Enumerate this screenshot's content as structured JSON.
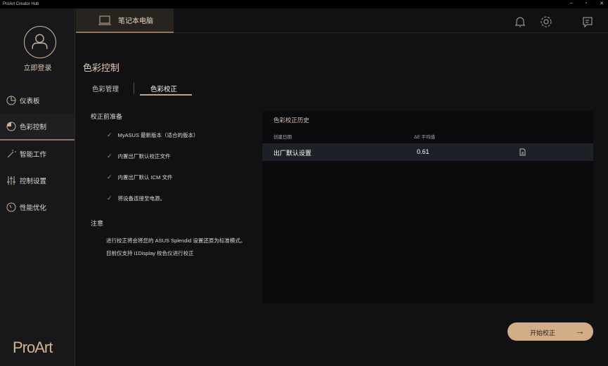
{
  "window": {
    "title": "ProArt Creator Hub",
    "minimize": "–",
    "maximize": "▫",
    "close": "✕"
  },
  "sidebar": {
    "login": "立即登录",
    "items": [
      {
        "label": "仪表板",
        "icon": "dashboard-icon"
      },
      {
        "label": "色彩控制",
        "icon": "color-control-icon",
        "active": true
      },
      {
        "label": "智能工作",
        "icon": "magic-wand-icon"
      },
      {
        "label": "控制设置",
        "icon": "sliders-icon"
      },
      {
        "label": "性能优化",
        "icon": "gauge-icon"
      }
    ],
    "logo": "ProArt"
  },
  "header": {
    "device_tab": "笔记本电脑"
  },
  "page": {
    "title": "色彩控制",
    "tabs": [
      {
        "label": "色彩管理"
      },
      {
        "label": "色彩校正",
        "active": true
      }
    ]
  },
  "prep": {
    "title": "校正前准备",
    "items": [
      "MyASUS 最新版本（适合的版本）",
      "内置出厂默认校正文件",
      "内置出厂默认 ICM 文件",
      "将设备连接至电源。"
    ]
  },
  "notes": {
    "title": "注意",
    "items": [
      "进行校正将会将您的 ASUS Splendid 设置还原为标准模式。",
      "目前仅支持 i1Display 校色仪进行校正"
    ]
  },
  "history": {
    "title": "色彩校正历史",
    "columns": [
      "创建日期",
      "ΔE 平均值"
    ],
    "rows": [
      {
        "name": "出厂默认设置",
        "delta_e": "0.61"
      }
    ]
  },
  "start_button": {
    "label": "开始校正",
    "arrow": "→"
  },
  "colors": {
    "accent": "#d2ad87",
    "background": "#111113"
  }
}
